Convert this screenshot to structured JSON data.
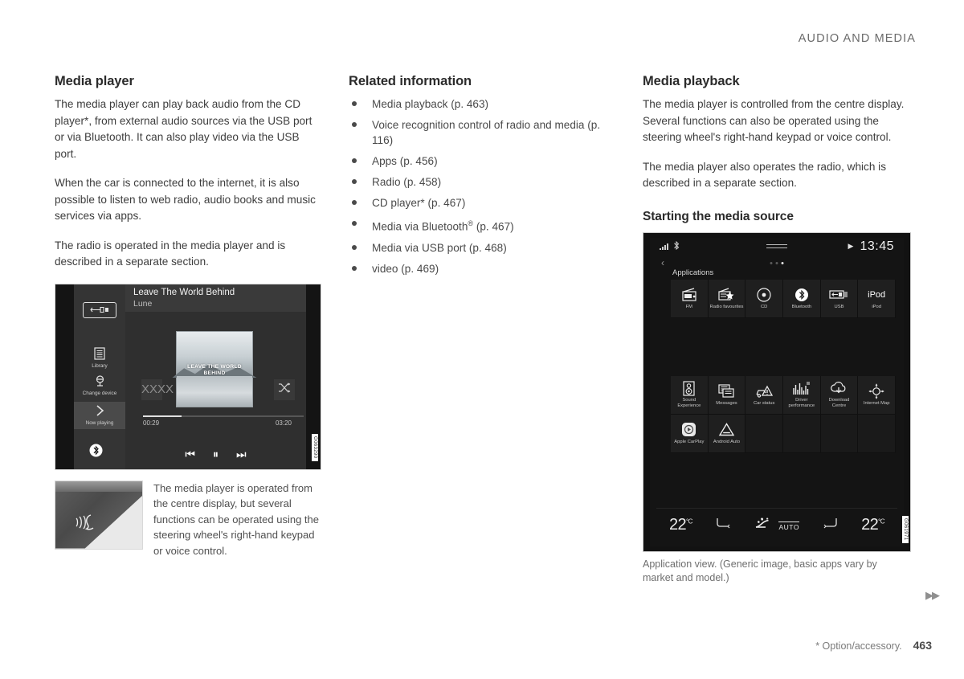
{
  "header": {
    "chapter": "AUDIO AND MEDIA"
  },
  "column_1": {
    "title": "Media player",
    "paragraphs": [
      "The media player can play back audio from the CD player*, from external audio sources via the USB port or via Bluetooth. It can also play video via the USB port.",
      "When the car is connected to the internet, it is also possible to listen to web radio, audio books and music services via apps.",
      "The radio is operated in the media player and is described in a separate section."
    ],
    "media_player_figure": {
      "track_title": "Leave The World Behind",
      "artist": "Lune",
      "album_art_text": "LEAVE THE WORLD BEHIND",
      "source_icon": "usb-icon",
      "sidebar": [
        {
          "label": "Library",
          "icon": "library-icon"
        },
        {
          "label": "Change device",
          "icon": "change-device-icon"
        },
        {
          "label": "Now playing",
          "icon": "now-playing-icon"
        }
      ],
      "bluetooth_icon": "bluetooth-icon",
      "repeat_label": "XXXX",
      "shuffle_icon": "shuffle-icon",
      "elapsed_time": "00:29",
      "total_time": "03:20",
      "controls": [
        {
          "name": "previous-track-button",
          "glyph": "⏮"
        },
        {
          "name": "pause-button",
          "glyph": "⏸"
        },
        {
          "name": "next-track-button",
          "glyph": "⏭"
        }
      ],
      "image_id": "G063290"
    },
    "wheel_figure": {
      "icon": "voice-control-icon",
      "caption": "The media player is operated from the centre display, but several functions can be operated using the steering wheel's right-hand keypad or voice control."
    }
  },
  "column_2": {
    "title": "Related information",
    "links": [
      {
        "text": "Media playback (p. 463)"
      },
      {
        "text": "Voice recognition control of radio and media (p. 116)"
      },
      {
        "text": "Apps (p. 456)"
      },
      {
        "text": "Radio (p. 458)"
      },
      {
        "text": "CD player* (p. 467)"
      },
      {
        "text": "Media via Bluetooth® (p. 467)",
        "has_sup": true,
        "pre": "Media via Bluetooth",
        "sup": "®",
        "post": " (p. 467)"
      },
      {
        "text": "Media via USB port (p. 468)"
      },
      {
        "text": "video (p. 469)"
      }
    ]
  },
  "column_3": {
    "title": "Media playback",
    "paragraphs": [
      "The media player is controlled from the centre display. Several functions can also be operated using the steering wheel's right-hand keypad or voice control.",
      "The media player also operates the radio, which is described in a separate section."
    ],
    "subtitle": "Starting the media source",
    "car_display": {
      "status_bar": {
        "signal_icon": "signal-bars-icon",
        "bluetooth_icon": "bluetooth-icon",
        "handle_icon": "drag-handle-icon",
        "play_icon": "play-icon",
        "clock": "13:45"
      },
      "back_icon": "back-chevron-icon",
      "page_dots": 3,
      "active_dot": 3,
      "app_view_title": "Applications",
      "tiles_row_1": [
        {
          "label": "FM",
          "icon": "fm-radio-icon"
        },
        {
          "label": "Radio favourites",
          "icon": "radio-favourites-icon"
        },
        {
          "label": "CD",
          "icon": "cd-disc-icon"
        },
        {
          "label": "Bluetooth",
          "icon": "bluetooth-icon"
        },
        {
          "label": "USB",
          "icon": "usb-icon"
        },
        {
          "label": "iPod",
          "icon": "ipod-icon"
        }
      ],
      "tiles_row_2": [
        {
          "label": "Sound Experience",
          "icon": "speaker-icon"
        },
        {
          "label": "Messages",
          "icon": "messages-icon"
        },
        {
          "label": "Car status",
          "icon": "car-warning-icon"
        },
        {
          "label": "Driver performance",
          "icon": "driver-performance-icon"
        },
        {
          "label": "Download Centre",
          "icon": "download-cloud-icon"
        },
        {
          "label": "Internet Map",
          "icon": "internet-map-icon"
        }
      ],
      "tiles_row_3": [
        {
          "label": "Apple CarPlay",
          "icon": "apple-carplay-icon"
        },
        {
          "label": "Android Auto",
          "icon": "android-auto-icon"
        }
      ],
      "climate_bar": {
        "left_temp": "22",
        "left_unit": "°C",
        "right_temp": "22",
        "right_unit": "°C",
        "left_seat_icon": "seat-heating-left-icon",
        "right_seat_icon": "seat-heating-right-icon",
        "fan_icon": "airflow-auto-icon",
        "auto_label": "AUTO"
      },
      "image_id": "G061971"
    },
    "caption": "Application view. (Generic image, basic apps vary by market and model.)"
  },
  "footer": {
    "option_note": "* Option/accessory.",
    "page_number": "463",
    "continuation_icon": "double-chevron-right-icon"
  }
}
